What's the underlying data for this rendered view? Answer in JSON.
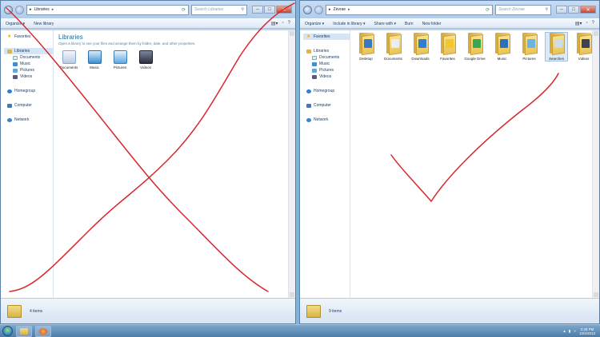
{
  "left_window": {
    "address_crumb": "Libraries",
    "search_placeholder": "Search Libraries",
    "toolbar": {
      "organize": "Organize ▾",
      "new_library": "New library"
    },
    "nav": {
      "favorites": "Favorites",
      "libraries": "Libraries",
      "library_children": [
        "Documents",
        "Music",
        "Pictures",
        "Videos"
      ],
      "homegroup": "Homegroup",
      "computer": "Computer",
      "network": "Network"
    },
    "heading": "Libraries",
    "subheading": "Open a library to see your files and arrange them by folder, date, and other properties.",
    "items": [
      {
        "label": "Documents",
        "icon": "documents-library-icon"
      },
      {
        "label": "Music",
        "icon": "music-library-icon"
      },
      {
        "label": "Pictures",
        "icon": "pictures-library-icon"
      },
      {
        "label": "Videos",
        "icon": "videos-library-icon"
      }
    ],
    "status": "4 items",
    "annotation": "red-x-cross-mark"
  },
  "right_window": {
    "address_crumb": "Zevrae",
    "search_placeholder": "Search Zevrae",
    "toolbar": {
      "organize": "Organize ▾",
      "include_in_library": "Include in library ▾",
      "share_with": "Share with ▾",
      "burn": "Burn",
      "new_folder": "New folder"
    },
    "nav": {
      "favorites": "Favorites",
      "libraries": "Libraries",
      "library_children": [
        "Documents",
        "Music",
        "Pictures",
        "Videos"
      ],
      "homegroup": "Homegroup",
      "computer": "Computer",
      "network": "Network"
    },
    "items": [
      {
        "label": "Desktop",
        "overlay_color": "#3a78c4"
      },
      {
        "label": "Documents",
        "overlay_color": "#e8eef6"
      },
      {
        "label": "Downloads",
        "overlay_color": "#2f7fd0"
      },
      {
        "label": "Favorites",
        "overlay_color": "#f3c62a"
      },
      {
        "label": "Google Drive",
        "overlay_color": "#3aa757"
      },
      {
        "label": "Music",
        "overlay_color": "#2d6fbf"
      },
      {
        "label": "Pictures",
        "overlay_color": "#6db2e6"
      },
      {
        "label": "Searches",
        "overlay_color": "#d0dbe8"
      },
      {
        "label": "Videos",
        "overlay_color": "#3f3f55"
      }
    ],
    "selected_item": "Searches",
    "status": "9 items",
    "annotation": "red-check-mark"
  },
  "taskbar": {
    "time": "2:28 PM",
    "date": "10/4/2013"
  },
  "colors": {
    "ink": "#d9262c",
    "accent": "#1d6b9e"
  }
}
